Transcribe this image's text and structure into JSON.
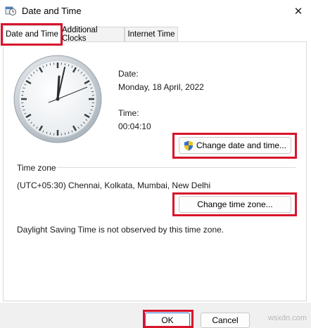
{
  "window": {
    "title": "Date and Time",
    "close_glyph": "✕"
  },
  "tabs": [
    {
      "label": "Date and Time",
      "active": true
    },
    {
      "label": "Additional Clocks",
      "active": false
    },
    {
      "label": "Internet Time",
      "active": false
    }
  ],
  "datetime": {
    "date_label": "Date:",
    "date_value": "Monday, 18 April, 2022",
    "time_label": "Time:",
    "time_value": "00:04:10",
    "change_button": "Change date and time..."
  },
  "timezone": {
    "section_label": "Time zone",
    "value": "(UTC+05:30) Chennai, Kolkata, Mumbai, New Delhi",
    "change_button": "Change time zone...",
    "dst_note": "Daylight Saving Time is not observed by this time zone."
  },
  "footer": {
    "ok": "OK",
    "cancel": "Cancel",
    "watermark": "wsxdn.com"
  },
  "colors": {
    "highlight": "#d8142c",
    "clock_face": "#f4f6f8",
    "clock_rim": "#c9d0d6",
    "hand": "#2b2f33"
  }
}
